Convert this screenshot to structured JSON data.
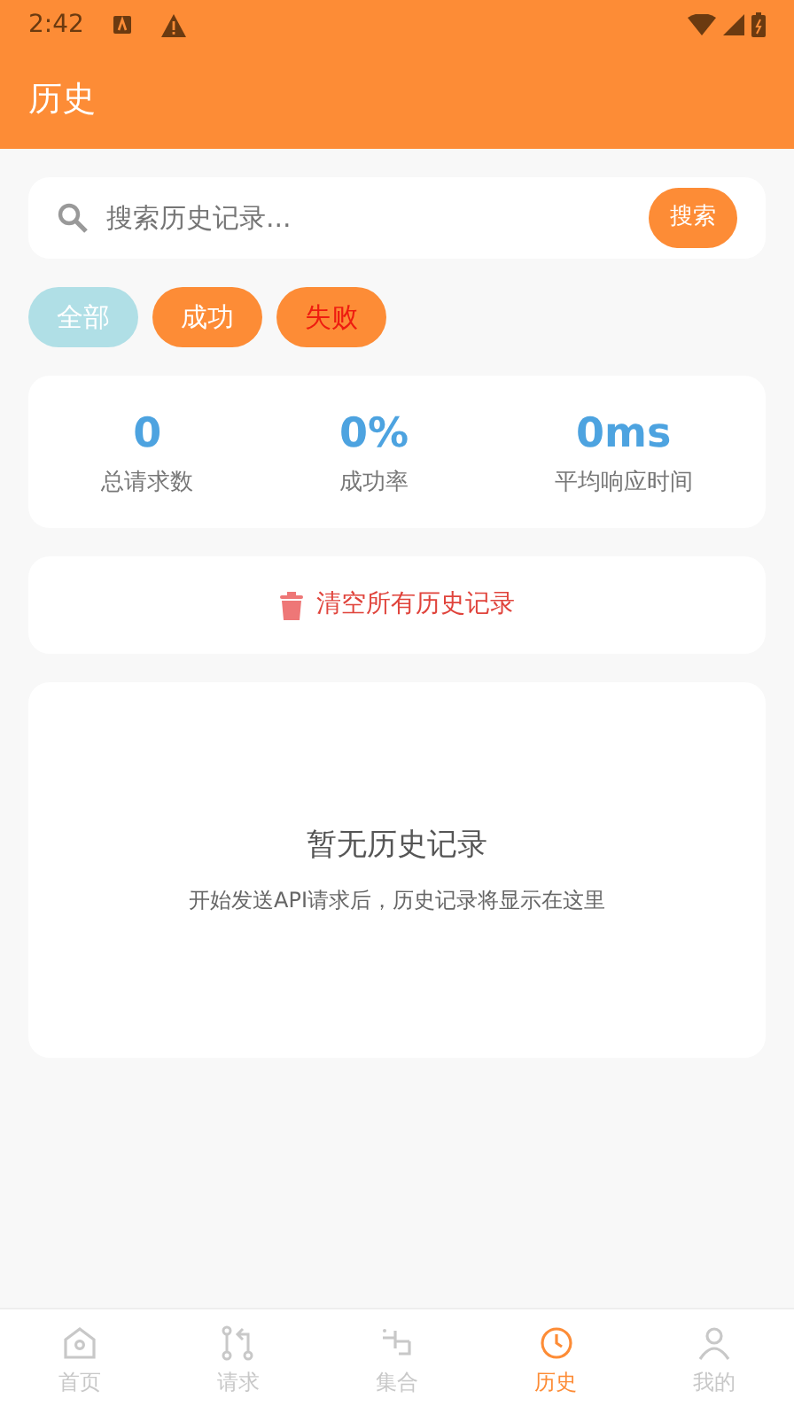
{
  "status_bar": {
    "time": "2:42"
  },
  "app_bar": {
    "title": "历史"
  },
  "search": {
    "placeholder": "搜索历史记录...",
    "button": "搜索"
  },
  "filters": [
    {
      "label": "全部",
      "kind": "all"
    },
    {
      "label": "成功",
      "kind": "success"
    },
    {
      "label": "失败",
      "kind": "failure"
    }
  ],
  "stats": [
    {
      "value": "0",
      "label": "总请求数"
    },
    {
      "value": "0%",
      "label": "成功率"
    },
    {
      "value": "0ms",
      "label": "平均响应时间"
    }
  ],
  "clear_button": "清空所有历史记录",
  "empty_state": {
    "title": "暂无历史记录",
    "message": "开始发送API请求后，历史记录将显示在这里"
  },
  "bottom_nav": [
    {
      "label": "首页",
      "kind": "home",
      "selected": false
    },
    {
      "label": "请求",
      "kind": "request",
      "selected": false
    },
    {
      "label": "集合",
      "kind": "collection",
      "selected": false
    },
    {
      "label": "历史",
      "kind": "history",
      "selected": true
    },
    {
      "label": "我的",
      "kind": "profile",
      "selected": false
    }
  ]
}
